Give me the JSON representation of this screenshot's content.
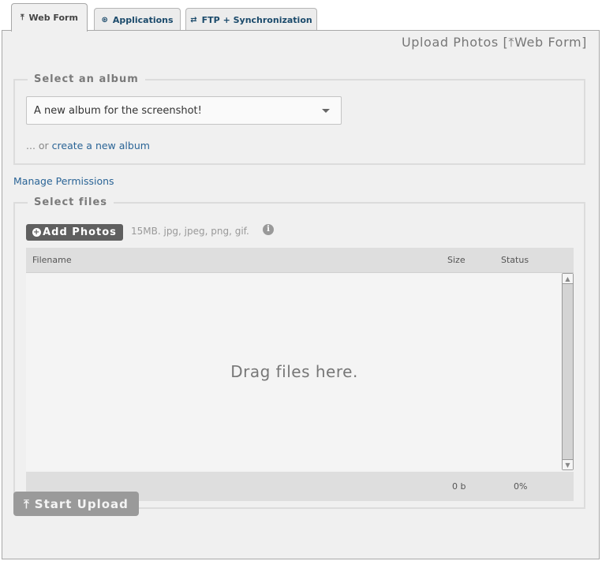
{
  "tabs": [
    {
      "label": "Web Form",
      "icon": "upload-icon",
      "glyph": "⤒",
      "active": true
    },
    {
      "label": "Applications",
      "icon": "globe-icon",
      "glyph": "⊛",
      "active": false
    },
    {
      "label": "FTP + Synchronization",
      "icon": "sync-arrows-icon",
      "glyph": "⇄",
      "active": false
    }
  ],
  "heading": {
    "prefix": "Upload Photos [",
    "icon": "upload-icon",
    "glyph": "⤒",
    "suffix": "Web Form]"
  },
  "album": {
    "legend": "Select an album",
    "selected": "A new album for the screenshot!",
    "or_prefix": "... or ",
    "create_link": "create a new album"
  },
  "manage_permissions": "Manage Permissions",
  "files": {
    "legend": "Select files",
    "add_button": "Add Photos",
    "limits": "15MB. jpg, jpeg, png, gif.",
    "info_glyph": "i",
    "columns": {
      "filename": "Filename",
      "size": "Size",
      "status": "Status"
    },
    "empty_message": "Drag files here.",
    "footer": {
      "total_size": "0 b",
      "total_percent": "0%"
    }
  },
  "start_upload": {
    "label": "Start Upload",
    "glyph": "⤒"
  },
  "colors": {
    "link": "#2a6496",
    "tab_text": "#1b4a6b",
    "button_dark": "#5f5f5f",
    "button_disabled": "#9a9a9a"
  }
}
